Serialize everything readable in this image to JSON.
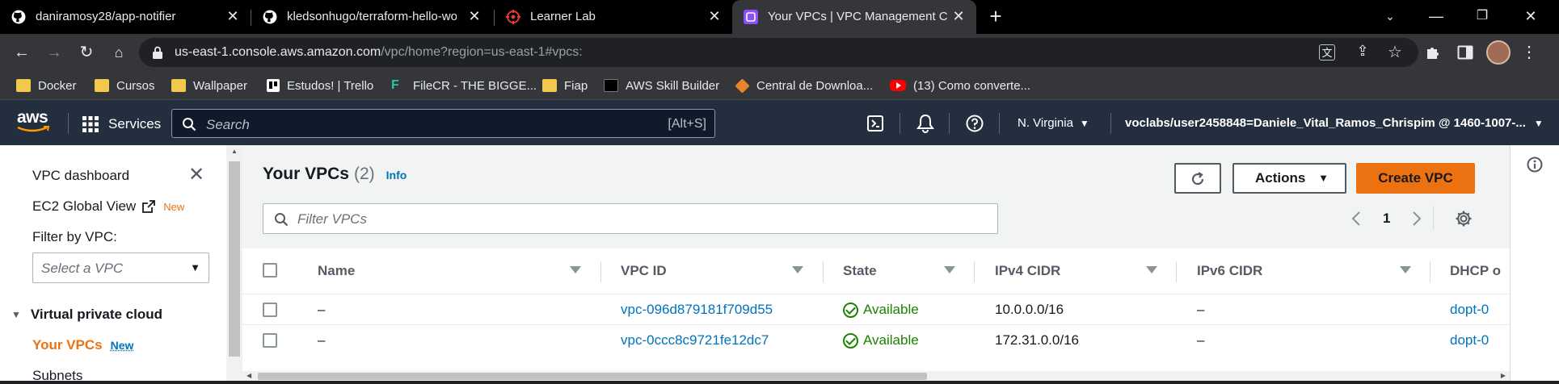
{
  "browser": {
    "tabs": [
      {
        "title": "daniramosy28/app-notifier",
        "favicon": "github-icon"
      },
      {
        "title": "kledsonhugo/terraform-hello-wo",
        "favicon": "github-icon"
      },
      {
        "title": "Learner Lab",
        "favicon": "learner-lab-icon"
      },
      {
        "title": "Your VPCs | VPC Management Co",
        "favicon": "vpc-icon",
        "active": true
      }
    ],
    "url_host": "us-east-1.console.aws.amazon.com",
    "url_rest": "/vpc/home?region=us-east-1#vpcs:",
    "bookmarks": [
      {
        "label": "Docker",
        "icon": "folder-icon"
      },
      {
        "label": "Cursos",
        "icon": "folder-icon"
      },
      {
        "label": "Wallpaper",
        "icon": "folder-icon"
      },
      {
        "label": "Estudos! | Trello",
        "icon": "trello-icon"
      },
      {
        "label": "FileCR - THE BIGGE...",
        "icon": "filecr-icon"
      },
      {
        "label": "Fiap",
        "icon": "folder-icon"
      },
      {
        "label": "AWS Skill Builder",
        "icon": "aws-icon"
      },
      {
        "label": "Central de Downloa...",
        "icon": "box-icon"
      },
      {
        "label": "(13) Como converte...",
        "icon": "youtube-icon"
      }
    ]
  },
  "aws_nav": {
    "logo": "aws",
    "services_label": "Services",
    "search_placeholder": "Search",
    "search_shortcut": "[Alt+S]",
    "region": "N. Virginia",
    "account": "voclabs/user2458848=Daniele_Vital_Ramos_Chrispim @ 1460-1007-..."
  },
  "sidebar": {
    "dashboard": "VPC dashboard",
    "ec2_global_view": "EC2 Global View",
    "new_badge": "New",
    "filter_label": "Filter by VPC:",
    "filter_placeholder": "Select a VPC",
    "section": "Virtual private cloud",
    "your_vpcs": "Your VPCs",
    "subnets": "Subnets"
  },
  "main": {
    "title": "Your VPCs",
    "count": "(2)",
    "info": "Info",
    "actions_label": "Actions",
    "create_label": "Create VPC",
    "filter_placeholder": "Filter VPCs",
    "page_number": "1",
    "columns": [
      "Name",
      "VPC ID",
      "State",
      "IPv4 CIDR",
      "IPv6 CIDR",
      "DHCP o"
    ],
    "rows": [
      {
        "name": "–",
        "vpc_id": "vpc-096d879181f709d55",
        "state": "Available",
        "ipv4": "10.0.0.0/16",
        "ipv6": "–",
        "dhcp": "dopt-0"
      },
      {
        "name": "–",
        "vpc_id": "vpc-0ccc8c9721fe12dc7",
        "state": "Available",
        "ipv4": "172.31.0.0/16",
        "ipv6": "–",
        "dhcp": "dopt-0"
      }
    ]
  },
  "colors": {
    "aws_nav": "#232f3e",
    "aws_orange": "#ec7211",
    "link": "#0073bb",
    "available": "#1d8102"
  }
}
